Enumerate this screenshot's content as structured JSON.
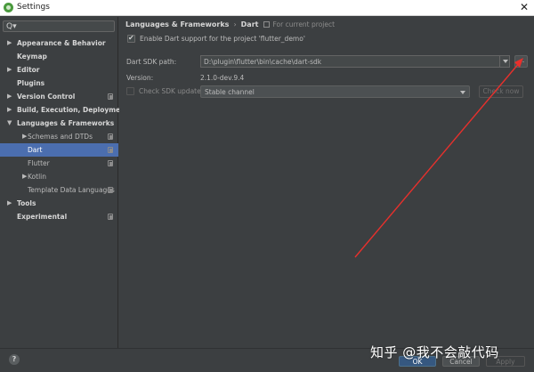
{
  "window": {
    "title": "Settings",
    "close_glyph": "✕"
  },
  "search": {
    "icon": "search-icon",
    "glyph": "Q▾"
  },
  "sidebar": {
    "items": [
      {
        "label": "Appearance & Behavior",
        "arrow": "▶",
        "bold": true,
        "copy": false,
        "indent": 0
      },
      {
        "label": "Keymap",
        "arrow": "",
        "bold": true,
        "copy": false,
        "indent": 0
      },
      {
        "label": "Editor",
        "arrow": "▶",
        "bold": true,
        "copy": false,
        "indent": 0
      },
      {
        "label": "Plugins",
        "arrow": "",
        "bold": true,
        "copy": false,
        "indent": 0
      },
      {
        "label": "Version Control",
        "arrow": "▶",
        "bold": true,
        "copy": true,
        "indent": 0
      },
      {
        "label": "Build, Execution, Deployment",
        "arrow": "▶",
        "bold": true,
        "copy": false,
        "indent": 0
      },
      {
        "label": "Languages & Frameworks",
        "arrow": "▼",
        "bold": true,
        "copy": false,
        "indent": 0
      },
      {
        "label": "Schemas and DTDs",
        "arrow": "▶",
        "bold": false,
        "copy": true,
        "indent": 1
      },
      {
        "label": "Dart",
        "arrow": "",
        "bold": false,
        "copy": true,
        "indent": 1,
        "selected": true
      },
      {
        "label": "Flutter",
        "arrow": "",
        "bold": false,
        "copy": true,
        "indent": 1
      },
      {
        "label": "Kotlin",
        "arrow": "▶",
        "bold": false,
        "copy": false,
        "indent": 1
      },
      {
        "label": "Template Data Languages",
        "arrow": "",
        "bold": false,
        "copy": true,
        "indent": 1
      },
      {
        "label": "Tools",
        "arrow": "▶",
        "bold": true,
        "copy": false,
        "indent": 0
      },
      {
        "label": "Experimental",
        "arrow": "",
        "bold": true,
        "copy": true,
        "indent": 0
      }
    ]
  },
  "breadcrumb": {
    "parent": "Languages & Frameworks",
    "separator": "›",
    "current": "Dart",
    "scope": "For current project"
  },
  "dart": {
    "enable_label": "Enable Dart support for the project 'flutter_demo'",
    "enable_checked": true,
    "sdk_path_label": "Dart SDK path:",
    "sdk_path_value": "D:\\plugin\\flutter\\bin\\cache\\dart-sdk",
    "browse_label": "...",
    "version_label": "Version:",
    "version_value": "2.1.0-dev.9.4",
    "check_update_label": "Check SDK update:",
    "channel_value": "Stable channel",
    "check_now_label": "Check now"
  },
  "footer": {
    "help": "?",
    "ok": "OK",
    "cancel": "Cancel",
    "apply": "Apply"
  },
  "watermark": "知乎 @我不会敲代码",
  "colors": {
    "selection": "#4b6eaf",
    "annotation_arrow": "#e8302c",
    "ok_button": "#365880"
  }
}
